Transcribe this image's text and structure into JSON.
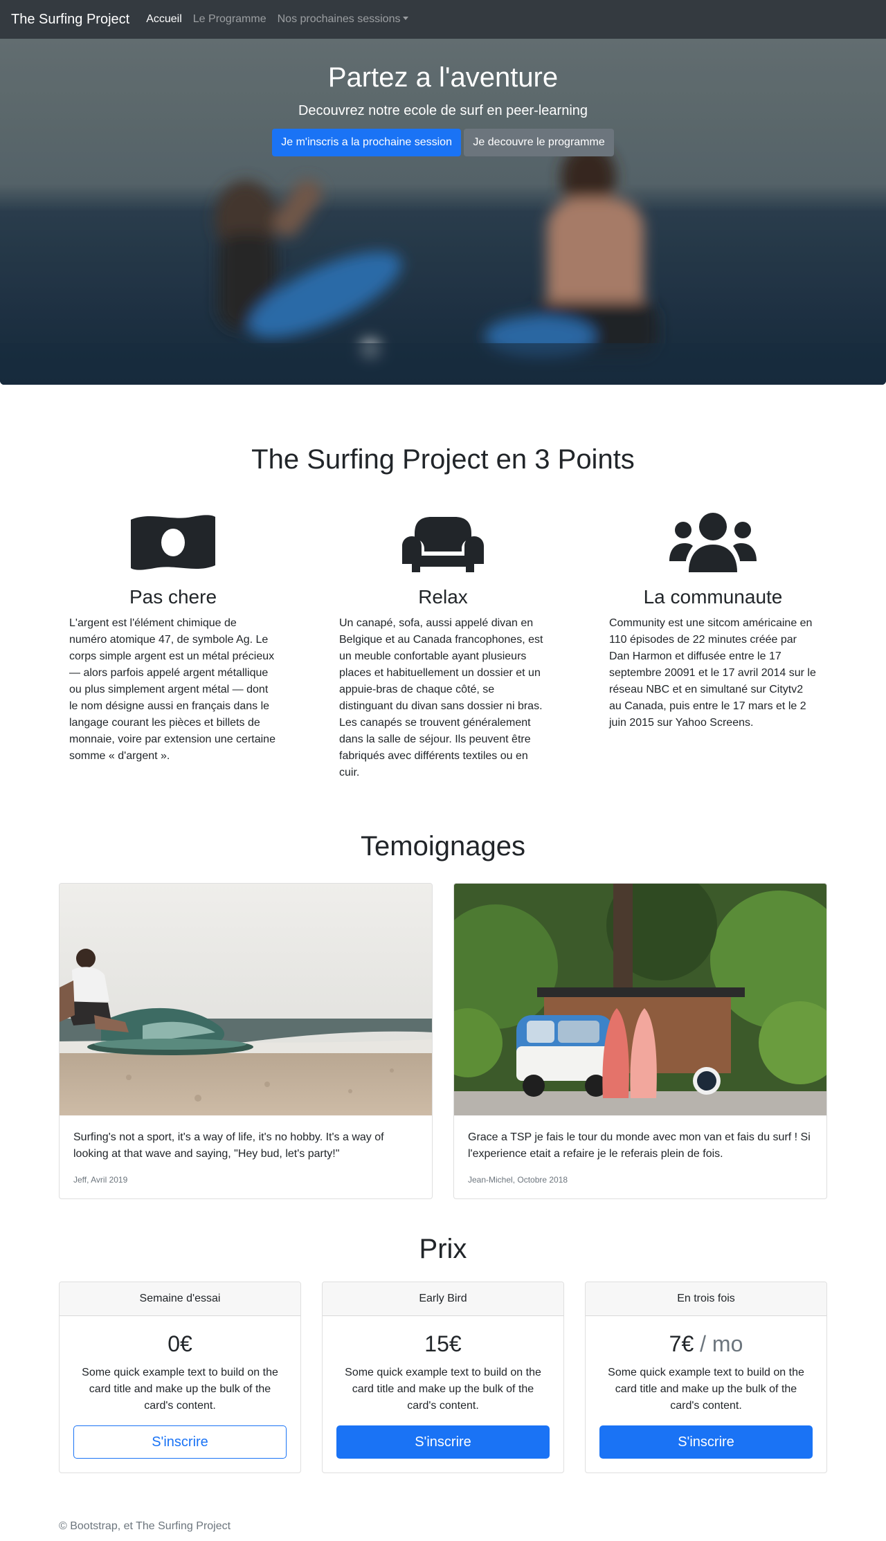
{
  "navbar": {
    "brand": "The Surfing Project",
    "links": [
      "Accueil",
      "Le Programme",
      "Nos prochaines sessions"
    ]
  },
  "hero": {
    "title": "Partez a l'aventure",
    "subtitle": "Decouvrez notre ecole de surf en peer-learning",
    "primary_button": "Je m'inscris a la prochaine session",
    "secondary_button": "Je decouvre le programme"
  },
  "points": {
    "title": "The Surfing Project en 3 Points",
    "items": [
      {
        "icon": "money-bill-icon",
        "heading": "Pas chere",
        "text": "L'argent est l'élément chimique de numéro atomique 47, de symbole Ag. Le corps simple argent est un métal précieux — alors parfois appelé argent métallique ou plus simplement argent métal — dont le nom désigne aussi en français dans le langage courant les pièces et billets de monnaie, voire par extension une certaine somme « d'argent »."
      },
      {
        "icon": "couch-icon",
        "heading": "Relax",
        "text": "Un canapé, sofa, aussi appelé divan en Belgique et au Canada francophones, est un meuble confortable ayant plusieurs places et habituellement un dossier et un appuie-bras de chaque côté, se distinguant du divan sans dossier ni bras. Les canapés se trouvent généralement dans la salle de séjour. Ils peuvent être fabriqués avec différents textiles ou en cuir."
      },
      {
        "icon": "users-icon",
        "heading": "La communaute",
        "text": "Community est une sitcom américaine en 110 épisodes de 22 minutes créée par Dan Harmon et diffusée entre le 17 septembre 20091 et le 17 avril 2014 sur le réseau NBC et en simultané sur Citytv2 au Canada, puis entre le 17 mars et le 2 juin 2015 sur Yahoo Screens."
      }
    ]
  },
  "testimonials": {
    "title": "Temoignages",
    "items": [
      {
        "text": "Surfing's not a sport, it's a way of life, it's no hobby. It's a way of looking at that wave and saying, \"Hey bud, let's party!\"",
        "author": "Jeff, Avril 2019"
      },
      {
        "text": "Grace a TSP je fais le tour du monde avec mon van et fais du surf ! Si l'experience etait a refaire je le referais plein de fois.",
        "author": "Jean-Michel, Octobre 2018"
      }
    ]
  },
  "prices": {
    "title": "Prix",
    "items": [
      {
        "header": "Semaine d'essai",
        "amount": "0€",
        "unit": "",
        "text": "Some quick example text to build on the card title and make up the bulk of the card's content.",
        "button": "S'inscrire",
        "button_style": "outline"
      },
      {
        "header": "Early Bird",
        "amount": "15€",
        "unit": "",
        "text": "Some quick example text to build on the card title and make up the bulk of the card's content.",
        "button": "S'inscrire",
        "button_style": "solid"
      },
      {
        "header": "En trois fois",
        "amount": "7€",
        "unit": " / mo",
        "text": "Some quick example text to build on the card title and make up the bulk of the card's content.",
        "button": "S'inscrire",
        "button_style": "solid"
      }
    ]
  },
  "footer": {
    "text": "© Bootstrap, et The Surfing Project"
  },
  "colors": {
    "navbar_bg": "#343a40",
    "primary": "#1a73f5",
    "secondary": "#6c757d",
    "text": "#212529"
  }
}
